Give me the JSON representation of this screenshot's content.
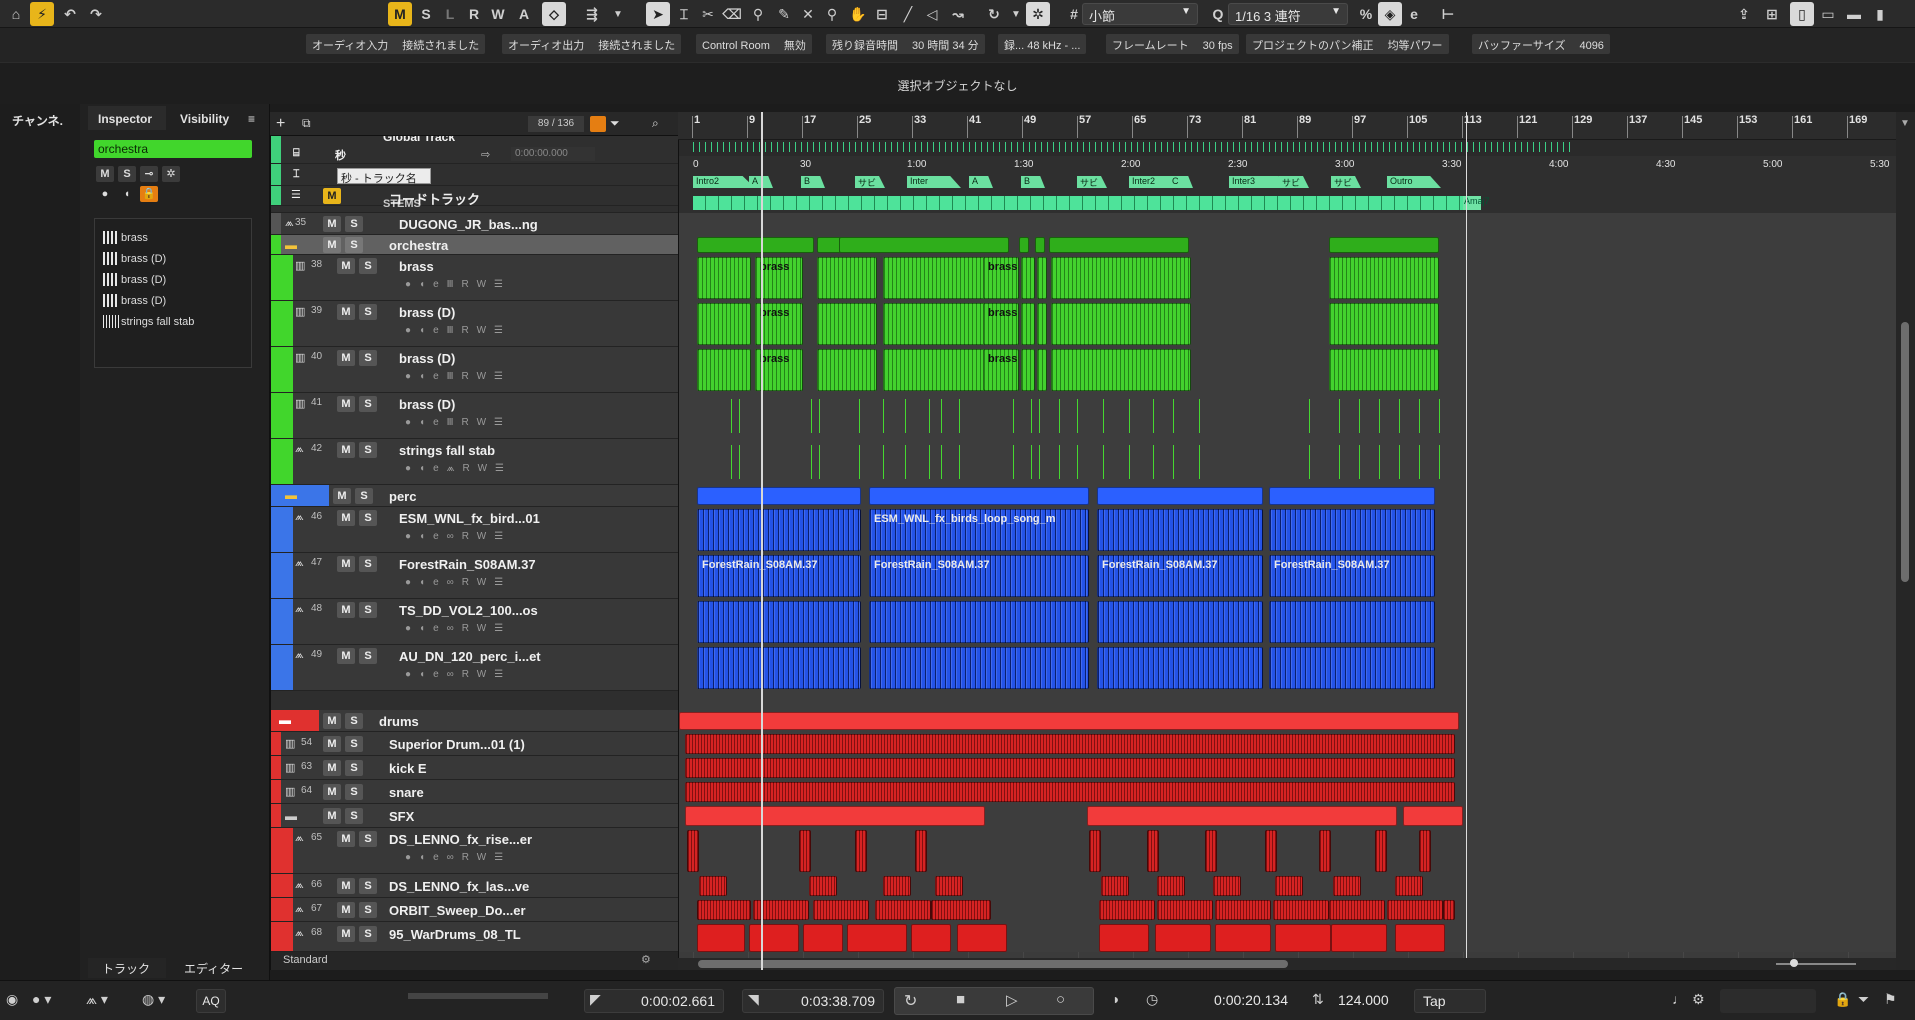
{
  "toolbar": {
    "mode_buttons": [
      "M",
      "S",
      "L",
      "R",
      "W",
      "A"
    ],
    "snap_type": "小節",
    "quantize": "1/16 3 連符"
  },
  "status": [
    {
      "label": "オーディオ入力",
      "value": "接続されました"
    },
    {
      "label": "オーディオ出力",
      "value": "接続されました"
    },
    {
      "label": "Control Room",
      "value": "無効"
    },
    {
      "label": "残り録音時間",
      "value": "30 時間 34 分"
    },
    {
      "label": "録... 48 kHz - ...",
      "value": ""
    },
    {
      "label": "フレームレート",
      "value": "30 fps"
    },
    {
      "label": "プロジェクトのパン補正",
      "value": "均等パワー"
    },
    {
      "label": "バッファーサイズ",
      "value": "4096"
    }
  ],
  "info_line": "選択オブジェクトなし",
  "left": {
    "channel_tab": "チャンネ.",
    "tabs": [
      "Inspector",
      "Visibility"
    ],
    "selected_track": "orchestra",
    "instruments": [
      "brass",
      "brass (D)",
      "brass (D)",
      "brass (D)",
      "strings fall stab"
    ],
    "bottom_tabs": [
      "トラック",
      "エディター"
    ]
  },
  "tracklist": {
    "count": "89 / 136",
    "global_rows": {
      "global": "Global Track",
      "time": "秒",
      "tooltip": "秒 - トラック名",
      "time_value": "0:00:00.000",
      "chord": "コードトラック",
      "stems": "STEMS"
    },
    "tracks": [
      {
        "num": "35",
        "name": "DUGONG_JR_bas...ng"
      },
      {
        "num": "",
        "name": "orchestra"
      },
      {
        "num": "38",
        "name": "brass"
      },
      {
        "num": "39",
        "name": "brass (D)"
      },
      {
        "num": "40",
        "name": "brass (D)"
      },
      {
        "num": "41",
        "name": "brass (D)"
      },
      {
        "num": "42",
        "name": "strings fall stab"
      },
      {
        "num": "",
        "name": "perc"
      },
      {
        "num": "46",
        "name": "ESM_WNL_fx_bird...01"
      },
      {
        "num": "47",
        "name": "ForestRain_S08AM.37"
      },
      {
        "num": "48",
        "name": "TS_DD_VOL2_100...os"
      },
      {
        "num": "49",
        "name": "AU_DN_120_perc_i...et"
      },
      {
        "num": "",
        "name": "drums"
      },
      {
        "num": "54",
        "name": "Superior Drum...01  (1)"
      },
      {
        "num": "63",
        "name": "kick E"
      },
      {
        "num": "64",
        "name": "snare"
      },
      {
        "num": "",
        "name": "SFX"
      },
      {
        "num": "65",
        "name": "DS_LENNO_fx_rise...er"
      },
      {
        "num": "66",
        "name": "DS_LENNO_fx_las...ve"
      },
      {
        "num": "67",
        "name": "ORBIT_Sweep_Do...er"
      },
      {
        "num": "68",
        "name": "95_WarDrums_08_TL"
      }
    ],
    "footer": "Standard"
  },
  "ruler": {
    "bars": [
      "1",
      "9",
      "17",
      "25",
      "33",
      "41",
      "49",
      "57",
      "65",
      "73",
      "81",
      "89",
      "97",
      "105",
      "113",
      "121",
      "129",
      "137",
      "145",
      "153",
      "161",
      "169"
    ],
    "times": [
      "0",
      "30",
      "1:00",
      "1:30",
      "2:00",
      "2:30",
      "3:00",
      "3:30",
      "4:00",
      "4:30",
      "5:00",
      "5:30"
    ]
  },
  "markers": [
    "Intro2",
    "A",
    "B",
    "サビ",
    "Inter",
    "A",
    "B",
    "サビ",
    "Inter2",
    "C",
    "Inter3",
    "サビ",
    "サビ",
    "Outro"
  ],
  "chord_end": "Amaj7",
  "parts": {
    "brass": "brass",
    "esm": "ESM_WNL_fx_birds_loop_song_m",
    "forest": "ForestRain_S08AM.37"
  },
  "transport": {
    "left_locator": "0:00:02.661",
    "right_locator": "0:03:38.709",
    "position": "0:00:20.134",
    "tempo": "124.000",
    "tap": "Tap",
    "aq": "AQ"
  }
}
